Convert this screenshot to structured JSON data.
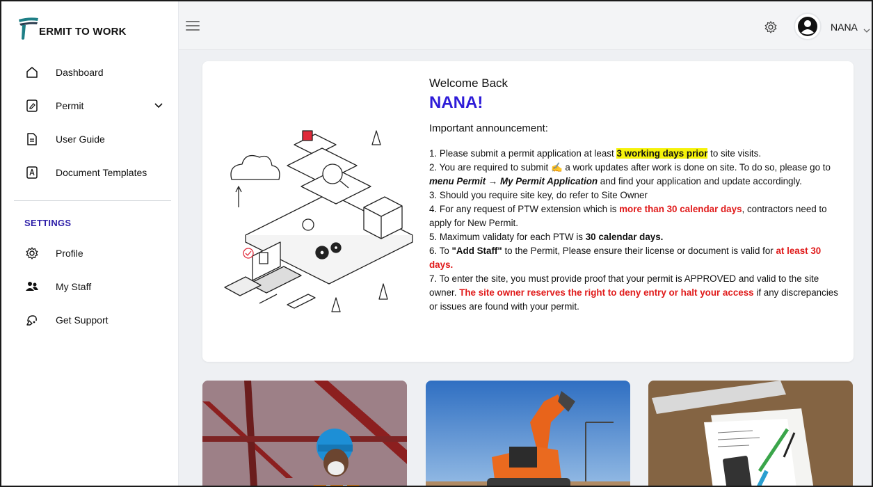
{
  "brand": {
    "text": "ERMIT TO WORK"
  },
  "sidebar": {
    "items": [
      {
        "label": "Dashboard",
        "icon": "home-icon"
      },
      {
        "label": "Permit",
        "icon": "permit-icon"
      },
      {
        "label": "User Guide",
        "icon": "document-icon"
      },
      {
        "label": "Document Templates",
        "icon": "pdf-icon"
      }
    ],
    "settings_heading": "SETTINGS",
    "settings_items": [
      {
        "label": "Profile",
        "icon": "gear-icon"
      },
      {
        "label": "My Staff",
        "icon": "users-icon"
      },
      {
        "label": "Get Support",
        "icon": "support-icon"
      }
    ]
  },
  "header": {
    "user_name": "NANA"
  },
  "welcome": {
    "greeting": "Welcome Back",
    "name": "NANA!",
    "announcement_title": "Important announcement:",
    "items": [
      [
        "1. Please submit a permit application at least ",
        "3 working days prior",
        " to site visits."
      ],
      [
        "2. You are required to submit ",
        "✍️",
        " a work updates after work is done on site. To do so, please go to ",
        "menu Permit → My Permit Application",
        " and find your application and update accordingly."
      ],
      [
        "3. Should you require site key, do refer to Site Owner"
      ],
      [
        "4. For any request of PTW extension which is ",
        "more than 30 calendar days",
        ", contractors need to apply for New Permit."
      ],
      [
        "5. Maximum validaty for each PTW is ",
        "30 calendar days."
      ],
      [
        "6. To ",
        "\"Add Staff\"",
        " to the Permit, Please ensure their license or document is valid for ",
        "at least 30 days",
        "."
      ],
      [
        "7. To enter the site, you must provide proof that your permit is APPROVED and valid to the site owner. ",
        "The site owner reserves the right to deny entry or halt your access",
        " if any discrepancies or issues are found with your permit."
      ]
    ]
  },
  "colors": {
    "accent": "#2e1cd8",
    "highlight": "#f5f20a",
    "alert": "#e01a1a",
    "brand_teal": "#1e7f86"
  }
}
